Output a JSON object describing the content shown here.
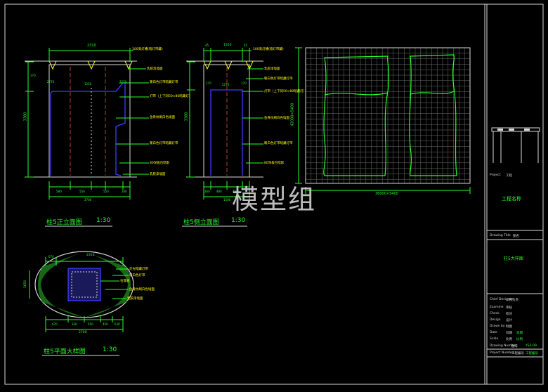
{
  "watermark": "模型组",
  "front_elevation": {
    "title": "柱5正立面图",
    "scale": "1:30",
    "dims_top": [
      "2310"
    ],
    "dims_left": [
      "170",
      "400",
      "3380",
      "120"
    ],
    "dims_bottom": [
      "580",
      "2700",
      "550",
      "1500",
      "550",
      "580",
      "200"
    ],
    "dims_mid": [
      "2270",
      "1250",
      "2270"
    ],
    "callouts": [
      "100宽灯槽(暗灯带藏)",
      "乳胶漆墙面",
      "暖白色灯带暗藏灯带",
      "灯带（上下同50×80暗藏灯）",
      "鱼骨纹刷白色墙面",
      "暖白色灯带暗藏灯带",
      "80深板包暗影",
      "乳胶漆墙面"
    ]
  },
  "side_elevation": {
    "title": "柱5侧立面图",
    "scale": "1:30",
    "dims_top": [
      "45",
      "1350",
      "45"
    ],
    "dims_left": [
      "170",
      "400",
      "3380",
      "120"
    ],
    "dims_bottom": [
      "260",
      "480",
      "450",
      "1500",
      "600",
      "400"
    ],
    "dims_mid": [
      "170",
      "2270",
      "170"
    ],
    "callouts": [
      "100宽灯槽(暗灯带藏)",
      "乳胶漆墙面",
      "暖白色灯带暗藏灯带",
      "灯带（上下同50×80暗藏灯）",
      "鱼骨纹刷白色墙面",
      "暖白色灯带暗藏灯带",
      "80深板包暗影"
    ]
  },
  "plan_detail": {
    "title": "柱5平面大样图",
    "scale": "1:30",
    "dims_top": [
      "670",
      "2310"
    ],
    "dims_left": [
      "1650"
    ],
    "dims_bottom": [
      "670",
      "330",
      "550",
      "450",
      "630"
    ],
    "dims_bottom_total": "2700",
    "callouts": [
      "灯光暗藏灯带",
      "暖白色灯带",
      "石膏板",
      "鱼骨纹刷白色墙面",
      "乳胶漆墙面"
    ]
  },
  "grid_panel": {
    "dim_bottom": "36000×5400",
    "dim_left": "42000×5400"
  },
  "title_block": {
    "project_label": "Project",
    "project_value": "工程",
    "project_name": "工程名称",
    "drawing_title_label": "Drawing Title",
    "drawing_title_value": "图名",
    "drawing_title": "柱5大样图",
    "rows": [
      {
        "label": "Chief Designer",
        "value": "工程负责"
      },
      {
        "label": "Examine",
        "value": "审核"
      },
      {
        "label": "Check",
        "value": "校对"
      },
      {
        "label": "Design",
        "value": "设计"
      },
      {
        "label": "Drawn by",
        "value": "制图"
      },
      {
        "label": "Date",
        "value": "日期",
        "extra": "日期"
      },
      {
        "label": "Scale",
        "value": "比例",
        "extra": "比例"
      },
      {
        "label": "Drawing Number",
        "value": "图号",
        "extra": "YS3-09"
      },
      {
        "label": "Project Number",
        "value": "工程编号",
        "extra": "工程编号"
      }
    ]
  },
  "colors": {
    "background": "#000000",
    "border": "#d8d8d8",
    "green": "#28ff28",
    "yellow": "#ffff00",
    "blue": "#3c3cff",
    "cyan": "#00c8c8",
    "grid": "#6e6e6e"
  }
}
